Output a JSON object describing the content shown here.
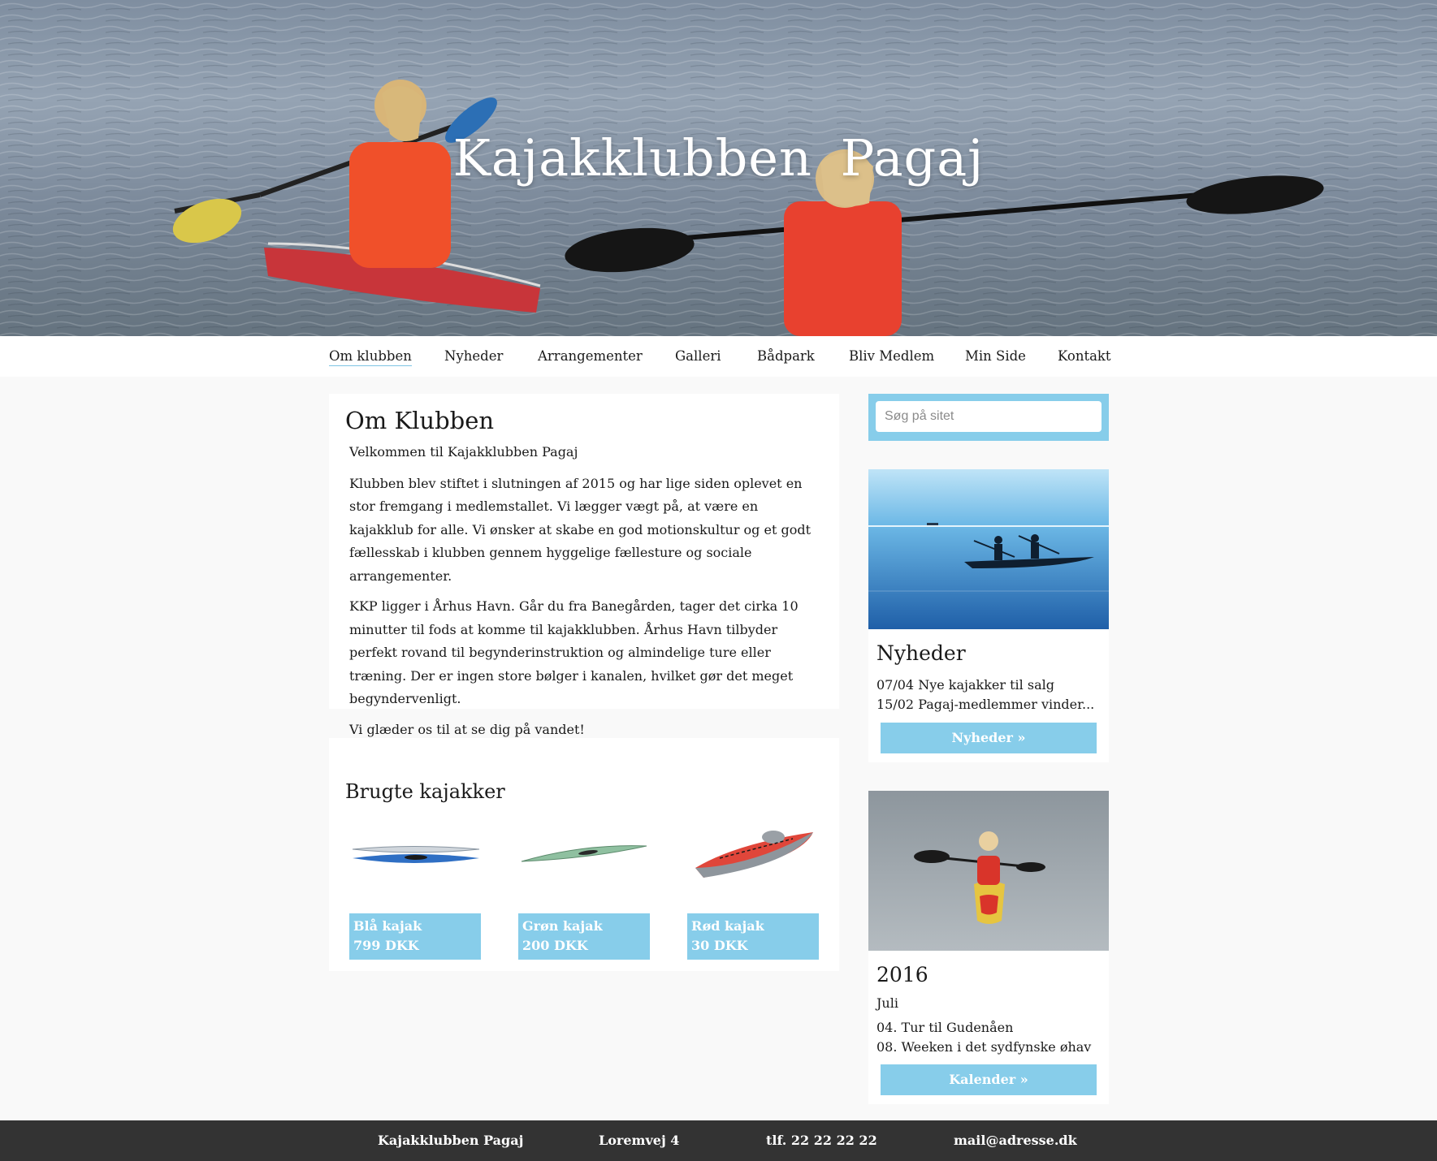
{
  "header": {
    "site_title": "Kajakklubben  Pagaj"
  },
  "nav": {
    "items": [
      "Om klubben",
      "Nyheder",
      "Arrangementer",
      "Galleri",
      "Bådpark",
      "Bliv Medlem",
      "Min Side",
      "Kontakt"
    ],
    "active": "Om klubben"
  },
  "about": {
    "title": "Om Klubben",
    "paragraphs": [
      "Velkommen til Kajakklubben Pagaj",
      "Klubben blev stiftet i slutningen af 2015 og har lige siden oplevet en stor fremgang i medlemstallet. Vi lægger vægt på, at være en kajakklub for alle. Vi ønsker at skabe en god motionskultur og et godt fællesskab i klubben gennem hyggelige fællesture og sociale arrangementer.",
      "KKP ligger i Århus Havn. Går du fra Banegården, tager det cirka 10 minutter til fods at komme til kajakklubben. Århus Havn tilbyder perfekt rovand til begynderinstruktion og almindelige ture eller træning. Der er ingen store bølger i kanalen, hvilket gør det meget begyndervenligt.",
      "Vi glæder os til at se dig på vandet!"
    ]
  },
  "used_kayaks": {
    "title": "Brugte kajakker",
    "items": [
      {
        "name": "Blå kajak",
        "price": "799 DKK",
        "color": "#2f6fc4"
      },
      {
        "name": "Grøn kajak",
        "price": "200 DKK",
        "color": "#8fc0a0"
      },
      {
        "name": "Rød kajak",
        "price": "30 DKK",
        "color": "#e0463a"
      }
    ]
  },
  "sidebar": {
    "search_placeholder": "Søg på sitet",
    "news": {
      "title": "Nyheder",
      "items": [
        "07/04 Nye kajakker til salg",
        "15/02 Pagaj-medlemmer vinder..."
      ],
      "button": "Nyheder »"
    },
    "calendar": {
      "year": "2016",
      "month": "Juli",
      "items": [
        "04. Tur til Gudenåen",
        "08. Weeken i det sydfynske øhav"
      ],
      "button": "Kalender »"
    }
  },
  "footer": {
    "items": [
      "Kajakklubben Pagaj",
      "Loremvej 4",
      "tlf. 22 22 22 22",
      "mail@adresse.dk"
    ]
  },
  "colors": {
    "accent": "#87cdea",
    "footer_bg": "#333333",
    "page_bg": "#f9f9f9"
  }
}
